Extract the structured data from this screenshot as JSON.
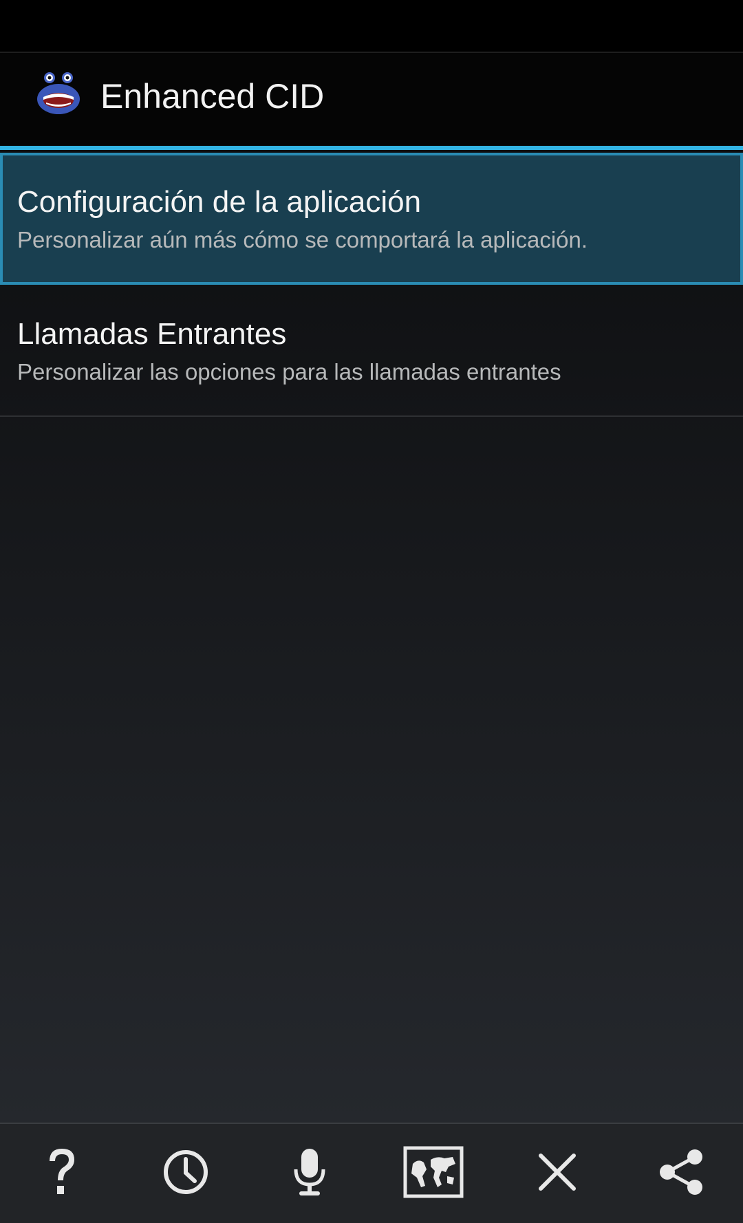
{
  "app": {
    "title": "Enhanced CID",
    "icon": "enhanced-cid-face-icon"
  },
  "colors": {
    "accent": "#33b5e5",
    "selected_background": "#193f50",
    "selected_border": "#2a8cb4",
    "title_text": "#f4f4f4",
    "summary_text": "#b7b9ba"
  },
  "preferences": [
    {
      "title": "Configuración de la aplicación",
      "summary": "Personalizar aún más cómo se comportará la aplicación.",
      "selected": true
    },
    {
      "title": "Llamadas Entrantes",
      "summary": "Personalizar las opciones para las llamadas entrantes",
      "selected": false
    }
  ],
  "bottom_bar": {
    "buttons": [
      {
        "icon": "help-icon"
      },
      {
        "icon": "clock-icon"
      },
      {
        "icon": "microphone-icon"
      },
      {
        "icon": "world-map-icon"
      },
      {
        "icon": "close-icon"
      },
      {
        "icon": "share-icon"
      }
    ]
  }
}
